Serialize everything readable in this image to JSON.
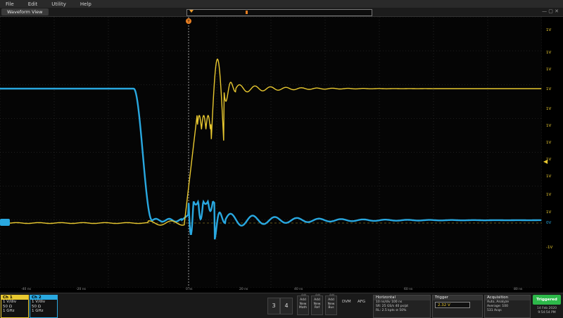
{
  "menu": [
    "File",
    "Edit",
    "Utility",
    "Help"
  ],
  "view_tab": "Waveform View",
  "right_levels": {
    "ch1": [
      "1V",
      "1V",
      "1V",
      "1V",
      "1V",
      "1V",
      "1V",
      "1V",
      "1V",
      "1V",
      "1V",
      "-1V"
    ],
    "ch2": [
      "0V"
    ]
  },
  "time_ticks": [
    "-40 ns",
    "-20 ns",
    "0 ns",
    "20 ns",
    "40 ns",
    "60 ns",
    "80 ns"
  ],
  "ch1": {
    "label": "Ch 1",
    "scale": "1 V/div",
    "impedance": "50 Ω",
    "bw": "1 GHz",
    "color": "#e8c830"
  },
  "ch2": {
    "label": "Ch 2",
    "scale": "1 V/div",
    "impedance": "50 Ω",
    "bw": "1 GHz",
    "color": "#29a8e0"
  },
  "channel_buttons": [
    "3",
    "4"
  ],
  "add_buttons": [
    {
      "tag": "Add",
      "label": "Add New Math"
    },
    {
      "tag": "Add",
      "label": "Add New Ref"
    },
    {
      "tag": "Add",
      "label": "Add New Bus"
    }
  ],
  "small_buttons": [
    "DVM",
    "AFG"
  ],
  "horizontal": {
    "title": "Horizontal",
    "rows": [
      "10 ns/div   100 ns",
      "SR: 25 GS/s   40 ps/pt",
      "RL: 2.5 kpts   ⊘ 50%"
    ]
  },
  "trigger": {
    "title": "Trigger",
    "value": "2.32 V"
  },
  "acquisition": {
    "title": "Acquisition",
    "rows": [
      "Auto,   Analyze",
      "Average: 100",
      "531 Acqs"
    ]
  },
  "status": {
    "label": "Triggered",
    "date": "14 Feb 2020",
    "time": "9:54:54 PM"
  },
  "trace_colors": {
    "ch1": "#e8c830",
    "ch2": "#29a8e0"
  }
}
